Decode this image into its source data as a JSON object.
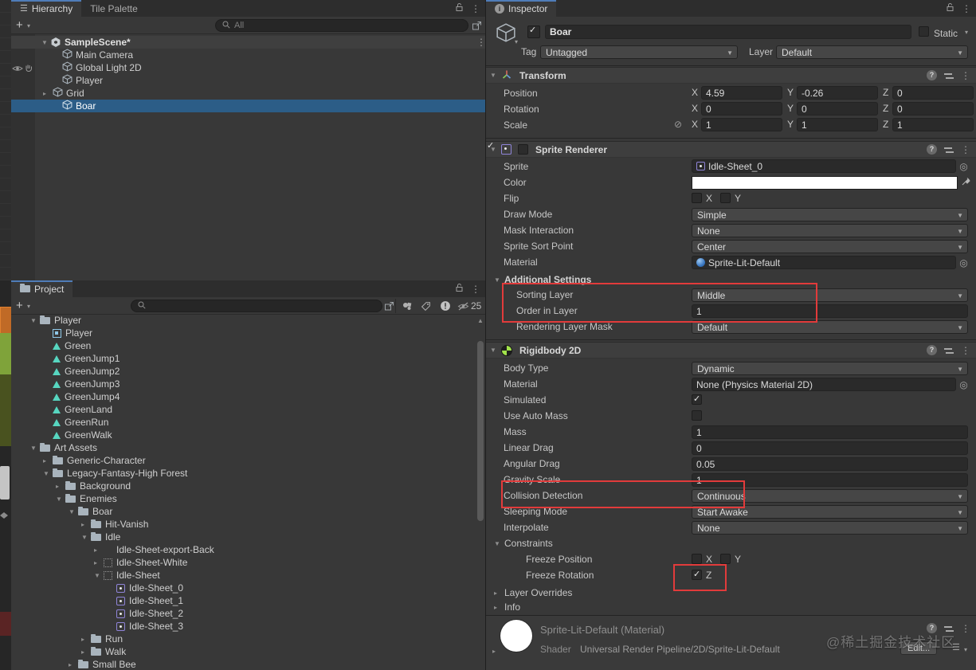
{
  "hierarchy": {
    "tabs": [
      {
        "label": "Hierarchy"
      },
      {
        "label": "Tile Palette"
      }
    ],
    "add_label": "+",
    "search_placeholder": "All",
    "scene_label": "SampleScene*",
    "items": [
      {
        "label": "Main Camera"
      },
      {
        "label": "Global Light 2D"
      },
      {
        "label": "Player"
      },
      {
        "label": "Grid"
      },
      {
        "label": "Boar"
      }
    ]
  },
  "project": {
    "tab_label": "Project",
    "add_label": "+",
    "hidden_count": "25",
    "items": [
      {
        "label": "Player"
      },
      {
        "label": "Player"
      },
      {
        "label": "Green"
      },
      {
        "label": "GreenJump1"
      },
      {
        "label": "GreenJump2"
      },
      {
        "label": "GreenJump3"
      },
      {
        "label": "GreenJump4"
      },
      {
        "label": "GreenLand"
      },
      {
        "label": "GreenRun"
      },
      {
        "label": "GreenWalk"
      },
      {
        "label": "Art Assets"
      },
      {
        "label": "Generic-Character"
      },
      {
        "label": "Legacy-Fantasy-High Forest"
      },
      {
        "label": "Background"
      },
      {
        "label": "Enemies"
      },
      {
        "label": "Boar"
      },
      {
        "label": "Hit-Vanish"
      },
      {
        "label": "Idle"
      },
      {
        "label": "Idle-Sheet-export-Back"
      },
      {
        "label": "Idle-Sheet-White"
      },
      {
        "label": "Idle-Sheet"
      },
      {
        "label": "Idle-Sheet_0"
      },
      {
        "label": "Idle-Sheet_1"
      },
      {
        "label": "Idle-Sheet_2"
      },
      {
        "label": "Idle-Sheet_3"
      },
      {
        "label": "Run"
      },
      {
        "label": "Walk"
      },
      {
        "label": "Small Bee"
      }
    ]
  },
  "axis": {
    "x": "X",
    "y": "Y",
    "z": "Z"
  },
  "inspector": {
    "tab_label": "Inspector",
    "header": {
      "name": "Boar",
      "static_label": "Static",
      "tag_label": "Tag",
      "tag_value": "Untagged",
      "layer_label": "Layer",
      "layer_value": "Default"
    },
    "transform": {
      "title": "Transform",
      "position_label": "Position",
      "rotation_label": "Rotation",
      "scale_label": "Scale",
      "position": {
        "x": "4.59",
        "y": "-0.26",
        "z": "0"
      },
      "rotation": {
        "x": "0",
        "y": "0",
        "z": "0"
      },
      "scale": {
        "x": "1",
        "y": "1",
        "z": "1"
      }
    },
    "sprite_renderer": {
      "title": "Sprite Renderer",
      "sprite_label": "Sprite",
      "sprite_value": "Idle-Sheet_0",
      "color_label": "Color",
      "flip_label": "Flip",
      "draw_mode_label": "Draw Mode",
      "draw_mode_value": "Simple",
      "mask_label": "Mask Interaction",
      "mask_value": "None",
      "sort_point_label": "Sprite Sort Point",
      "sort_point_value": "Center",
      "material_label": "Material",
      "material_value": "Sprite-Lit-Default",
      "additional_label": "Additional Settings",
      "sorting_layer_label": "Sorting Layer",
      "sorting_layer_value": "Middle",
      "order_label": "Order in Layer",
      "order_value": "1",
      "render_mask_label": "Rendering Layer Mask",
      "render_mask_value": "Default"
    },
    "rigidbody": {
      "title": "Rigidbody 2D",
      "body_type_label": "Body Type",
      "body_type_value": "Dynamic",
      "material_label": "Material",
      "material_value": "None (Physics Material 2D)",
      "simulated_label": "Simulated",
      "auto_mass_label": "Use Auto Mass",
      "mass_label": "Mass",
      "mass_value": "1",
      "linear_drag_label": "Linear Drag",
      "linear_drag_value": "0",
      "angular_drag_label": "Angular Drag",
      "angular_drag_value": "0.05",
      "gravity_label": "Gravity Scale",
      "gravity_value": "1",
      "collision_label": "Collision Detection",
      "collision_value": "Continuous",
      "sleeping_label": "Sleeping Mode",
      "sleeping_value": "Start Awake",
      "interpolate_label": "Interpolate",
      "interpolate_value": "None",
      "constraints_label": "Constraints",
      "freeze_pos_label": "Freeze Position",
      "freeze_rot_label": "Freeze Rotation",
      "layer_overrides_label": "Layer Overrides",
      "info_label": "Info"
    },
    "material_footer": {
      "title": "Sprite-Lit-Default (Material)",
      "shader_label": "Shader",
      "shader_value": "Universal Render Pipeline/2D/Sprite-Lit-Default",
      "edit_label": "Edit..."
    }
  },
  "watermark": "@稀土掘金技术社区",
  "colors": {
    "selection": "#2C5D87",
    "tab_accent": "#4F7CB8",
    "annotation": "#E23B3B",
    "folder_icon": "#A9B4BD",
    "animation_icon": "#57D6C0",
    "sprite_icon": "#8F84D8",
    "rigidbody_icon_green": "#A2E34B",
    "panel_bg": "#383838",
    "field_bg": "#2A2A2A"
  }
}
